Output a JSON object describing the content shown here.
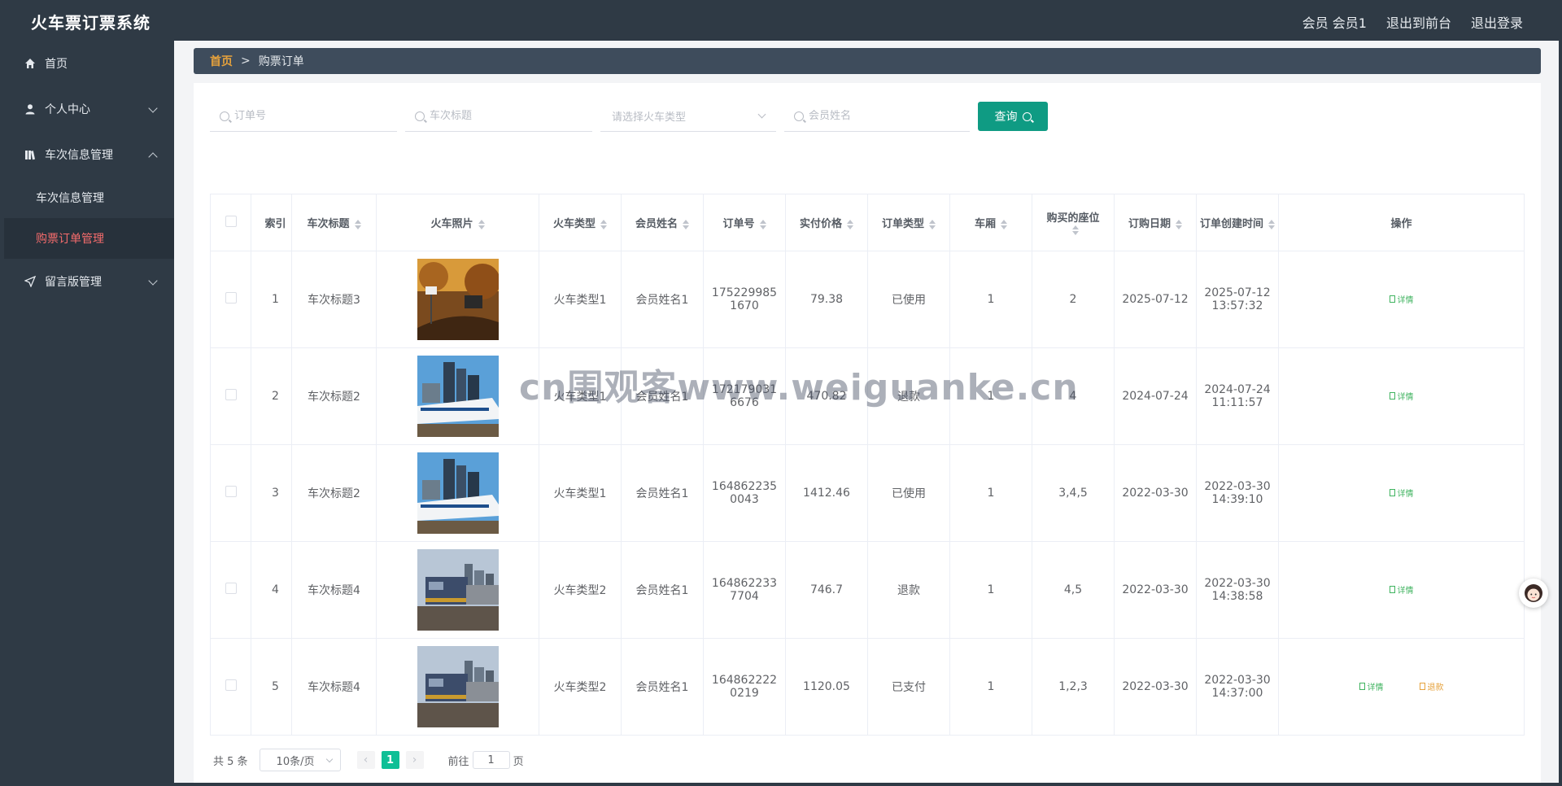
{
  "app": {
    "title": "火车票订票系统"
  },
  "header": {
    "member": "会员 会员1",
    "front": "退出到前台",
    "logout": "退出登录"
  },
  "sidebar": {
    "home": "首页",
    "personal": "个人中心",
    "train_mgmt": "车次信息管理",
    "train_info": "车次信息管理",
    "orders": "购票订单管理",
    "board": "留言版管理"
  },
  "breadcrumb": {
    "home": "首页",
    "sep": ">",
    "current": "购票订单"
  },
  "search": {
    "order_no_placeholder": "订单号",
    "title_placeholder": "车次标题",
    "type_placeholder": "请选择火车类型",
    "member_placeholder": "会员姓名",
    "query": "查询"
  },
  "table": {
    "headers": {
      "index": "索引",
      "title": "车次标题",
      "photo": "火车照片",
      "type": "火车类型",
      "member": "会员姓名",
      "order_no": "订单号",
      "price": "实付价格",
      "order_type": "订单类型",
      "car": "车厢",
      "seat": "购买的座位",
      "date": "订购日期",
      "created": "订单创建时间",
      "ops": "操作"
    },
    "rows": [
      {
        "index": "1",
        "title": "车次标题3",
        "type": "火车类型1",
        "member": "会员姓名1",
        "order_no_1": "175229985",
        "order_no_2": "1670",
        "price": "79.38",
        "order_type": "已使用",
        "car": "1",
        "seat": "2",
        "date": "2025-07-12",
        "created_1": "2025-07-12",
        "created_2": "13:57:32",
        "detail": "详情",
        "photo": "autumn-train"
      },
      {
        "index": "2",
        "title": "车次标题2",
        "type": "火车类型1",
        "member": "会员姓名1",
        "order_no_1": "172179031",
        "order_no_2": "6676",
        "price": "470.82",
        "order_type": "退款",
        "car": "1",
        "seat": "4",
        "date": "2024-07-24",
        "created_1": "2024-07-24",
        "created_2": "11:11:57",
        "detail": "详情",
        "photo": "city-highspeed"
      },
      {
        "index": "3",
        "title": "车次标题2",
        "type": "火车类型1",
        "member": "会员姓名1",
        "order_no_1": "164862235",
        "order_no_2": "0043",
        "price": "1412.46",
        "order_type": "已使用",
        "car": "1",
        "seat": "3,4,5",
        "date": "2022-03-30",
        "created_1": "2022-03-30",
        "created_2": "14:39:10",
        "detail": "详情",
        "photo": "city-highspeed"
      },
      {
        "index": "4",
        "title": "车次标题4",
        "type": "火车类型2",
        "member": "会员姓名1",
        "order_no_1": "164862233",
        "order_no_2": "7704",
        "price": "746.7",
        "order_type": "退款",
        "car": "1",
        "seat": "4,5",
        "date": "2022-03-30",
        "created_1": "2022-03-30",
        "created_2": "14:38:58",
        "detail": "详情",
        "photo": "freight-train"
      },
      {
        "index": "5",
        "title": "车次标题4",
        "type": "火车类型2",
        "member": "会员姓名1",
        "order_no_1": "164862222",
        "order_no_2": "0219",
        "price": "1120.05",
        "order_type": "已支付",
        "car": "1",
        "seat": "1,2,3",
        "date": "2022-03-30",
        "created_1": "2022-03-30",
        "created_2": "14:37:00",
        "detail": "详情",
        "refund": "退款",
        "photo": "freight-train"
      }
    ]
  },
  "pager": {
    "total": "共 5 条",
    "page_size": "10条/页",
    "current": "1",
    "goto": "前往",
    "goto_value": "1",
    "page_unit": "页"
  },
  "watermark": "cn围观客www.weiguanke.cn",
  "colors": {
    "accent": "#0f9b83",
    "active_menu": "#f56c6c",
    "sidebar": "#2f3a45"
  }
}
